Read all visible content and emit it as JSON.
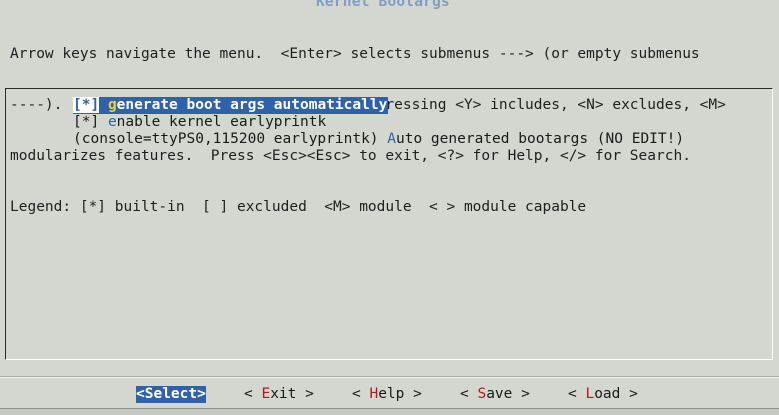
{
  "window": {
    "title": "Kernel Bootargs"
  },
  "help_lines": [
    "Arrow keys navigate the menu.  <Enter> selects submenus ---> (or empty submenus",
    "----).  Highlighted letters are hotkeys.  Pressing <Y> includes, <N> excludes, <M>",
    "modularizes features.  Press <Esc><Esc> to exit, <?> for Help, </> for Search.",
    "Legend: [*] built-in  [ ] excluded  <M> module  < > module capable"
  ],
  "menu": {
    "items": [
      {
        "checkbox": "[*]",
        "hotkey": "g",
        "rest": "enerate boot args automatically",
        "selected": true
      },
      {
        "checkbox": "[*]",
        "hotkey": "e",
        "rest": "nable kernel earlyprintk",
        "selected": false
      },
      {
        "value": "(console=ttyPS0,115200 earlyprintk)",
        "hotkey": "A",
        "rest": "uto generated bootargs (NO EDIT!)"
      }
    ]
  },
  "buttons": {
    "select": {
      "open": "<",
      "hotkey": "S",
      "rest": "elect",
      "close": ">"
    },
    "exit": {
      "open": "< ",
      "hotkey": "E",
      "rest": "xit",
      "close": " >"
    },
    "help": {
      "open": "< ",
      "hotkey": "H",
      "rest": "elp",
      "close": " >"
    },
    "save": {
      "open": "< ",
      "hotkey": "S",
      "rest": "ave",
      "close": " >"
    },
    "load": {
      "open": "< ",
      "hotkey": "L",
      "rest": "oad",
      "close": " >"
    }
  },
  "colors": {
    "background": "#d3d7cf",
    "selection": "#2f62a8",
    "title": "#7f9fc4",
    "hotkey": "#c49c00",
    "button_hotkey": "#b41a1a"
  }
}
